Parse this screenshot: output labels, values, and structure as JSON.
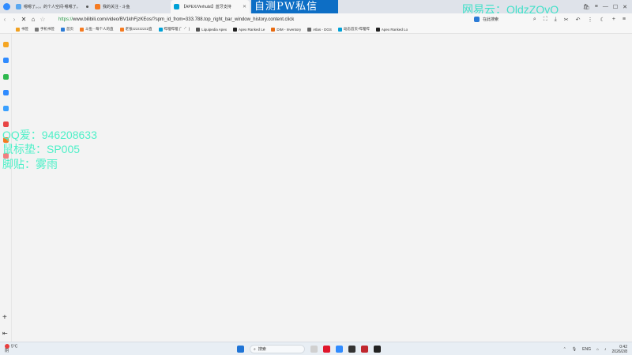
{
  "tabs": [
    {
      "title": "嗯嗯了。。。的个人空间-嗯嗯了。",
      "active": false
    },
    {
      "title": "我的关注 - 斗鱼",
      "active": false
    },
    {
      "title": "【APEX/Verhulst】蓝牙支持",
      "active": true
    }
  ],
  "overlays": {
    "banner": "自测PW私信",
    "wangyi": "网易云：OldzZOvO",
    "qq": "QQ爱：946208633",
    "mousepad": "鼠标垫：SP005",
    "sticker": "脚贴：雾雨"
  },
  "address": {
    "scheme": "https://",
    "rest": "www.bilibili.com/video/BV1khFjzKEos/?spm_id_from=333.788.top_right_bar_window_history.content.click",
    "search_hint": "在此搜索"
  },
  "bookmarks": [
    {
      "label": "书签",
      "color": "#f0a020"
    },
    {
      "label": "手机书签",
      "color": "#777777"
    },
    {
      "label": "首页",
      "color": "#2b7bd6"
    },
    {
      "label": "斗鱼 - 每个人的直",
      "color": "#f57a20"
    },
    {
      "label": "老张zzzzzzzz2直",
      "color": "#f57a20"
    },
    {
      "label": "哔哩哔哩 (゜-゜)",
      "color": "#00a1d6"
    },
    {
      "label": "Liquipedia Apex",
      "color": "#555555"
    },
    {
      "label": "Apex Ranked Le",
      "color": "#222222"
    },
    {
      "label": "DIM - Inventory",
      "color": "#e86a10"
    },
    {
      "label": "Atlas - DGS",
      "color": "#666666"
    },
    {
      "label": "动态首页-哔哩哔",
      "color": "#00a1d6"
    },
    {
      "label": "Apex Ranked Lo",
      "color": "#222222"
    }
  ],
  "taskbar": {
    "temp": "5°C",
    "weather": "阴",
    "search": "搜索",
    "lang": "ENG",
    "time": "0:42",
    "date": "2026/2/8"
  },
  "colors": {
    "overlay_text": "#4ff0c8",
    "banner_bg": "#0d6ec5"
  }
}
